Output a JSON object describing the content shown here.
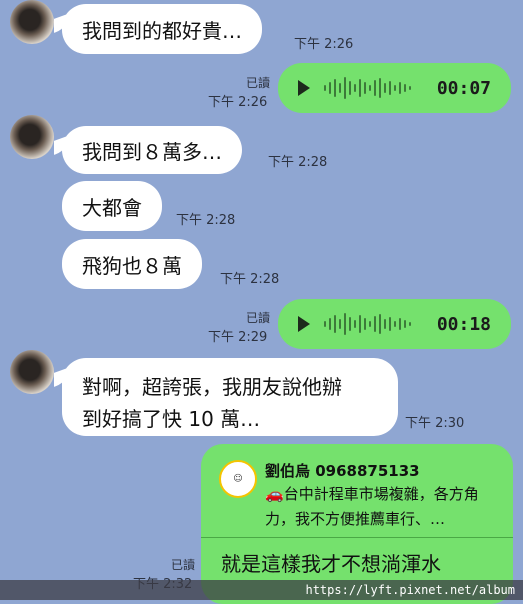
{
  "messages": {
    "m1": {
      "text": "我問到的都好貴…",
      "time": "下午 2:26"
    },
    "v1": {
      "read": "已讀",
      "time": "下午 2:26",
      "duration": "00:07"
    },
    "m2": {
      "text": "我問到８萬多…",
      "time": "下午 2:28"
    },
    "m3": {
      "text": "大都會",
      "time": "下午 2:28"
    },
    "m4": {
      "text": "飛狗也８萬",
      "time": "下午 2:28"
    },
    "v2": {
      "read": "已讀",
      "time": "下午 2:29",
      "duration": "00:18"
    },
    "m5": {
      "line1": "對啊，超誇張，我朋友說他辦",
      "line2": "到好搞了快 10 萬…",
      "time": "下午 2:30"
    },
    "reply": {
      "read": "已讀",
      "time": "下午 2:32",
      "quoted_name": "劉伯烏 0968875133",
      "quoted_icon": "car-icon",
      "quoted_text": "台中計程車市場複雜，各方角力，我不方便推薦車行、…",
      "text": "就是這樣我才不想淌渾水"
    }
  },
  "watermark": "https://lyft.pixnet.net/album"
}
